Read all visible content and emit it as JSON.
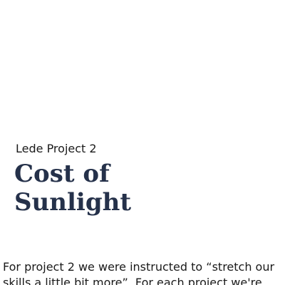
{
  "header": {
    "kicker": "Lede Project 2",
    "title_line_1": "Cost of",
    "title_line_2": "Sunlight"
  },
  "article": {
    "line_1": "For project 2 we were instructed to “stretch our",
    "line_2": "skills a little bit more”. For each project we're"
  }
}
